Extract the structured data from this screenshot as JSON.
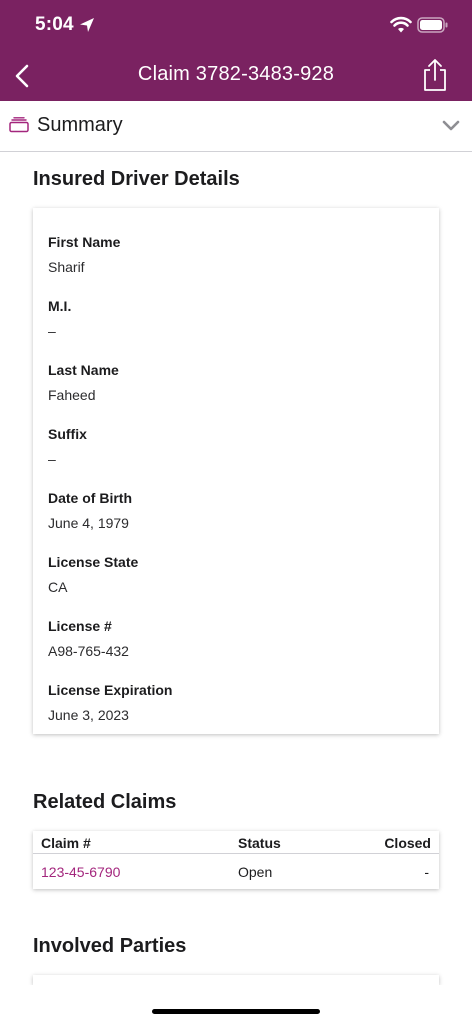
{
  "status_bar": {
    "time": "5:04"
  },
  "header": {
    "title": "Claim 3782-3483-928"
  },
  "summary": {
    "label": "Summary"
  },
  "insured_driver": {
    "title": "Insured Driver Details",
    "fields": [
      {
        "label": "First Name",
        "value": "Sharif"
      },
      {
        "label": "M.I.",
        "value": "–"
      },
      {
        "label": "Last Name",
        "value": "Faheed"
      },
      {
        "label": "Suffix",
        "value": "–"
      },
      {
        "label": "Date of Birth",
        "value": "June 4, 1979"
      },
      {
        "label": "License State",
        "value": "CA"
      },
      {
        "label": "License #",
        "value": "A98-765-432"
      },
      {
        "label": "License Expiration",
        "value": "June 3, 2023"
      }
    ]
  },
  "related_claims": {
    "title": "Related Claims",
    "columns": {
      "claim": "Claim #",
      "status": "Status",
      "closed": "Closed"
    },
    "rows": [
      {
        "claim": "123-45-6790",
        "status": "Open",
        "closed": "-"
      }
    ]
  },
  "involved_parties": {
    "title": "Involved Parties"
  },
  "colors": {
    "brand": "#7a2261",
    "link": "#a3267d"
  }
}
